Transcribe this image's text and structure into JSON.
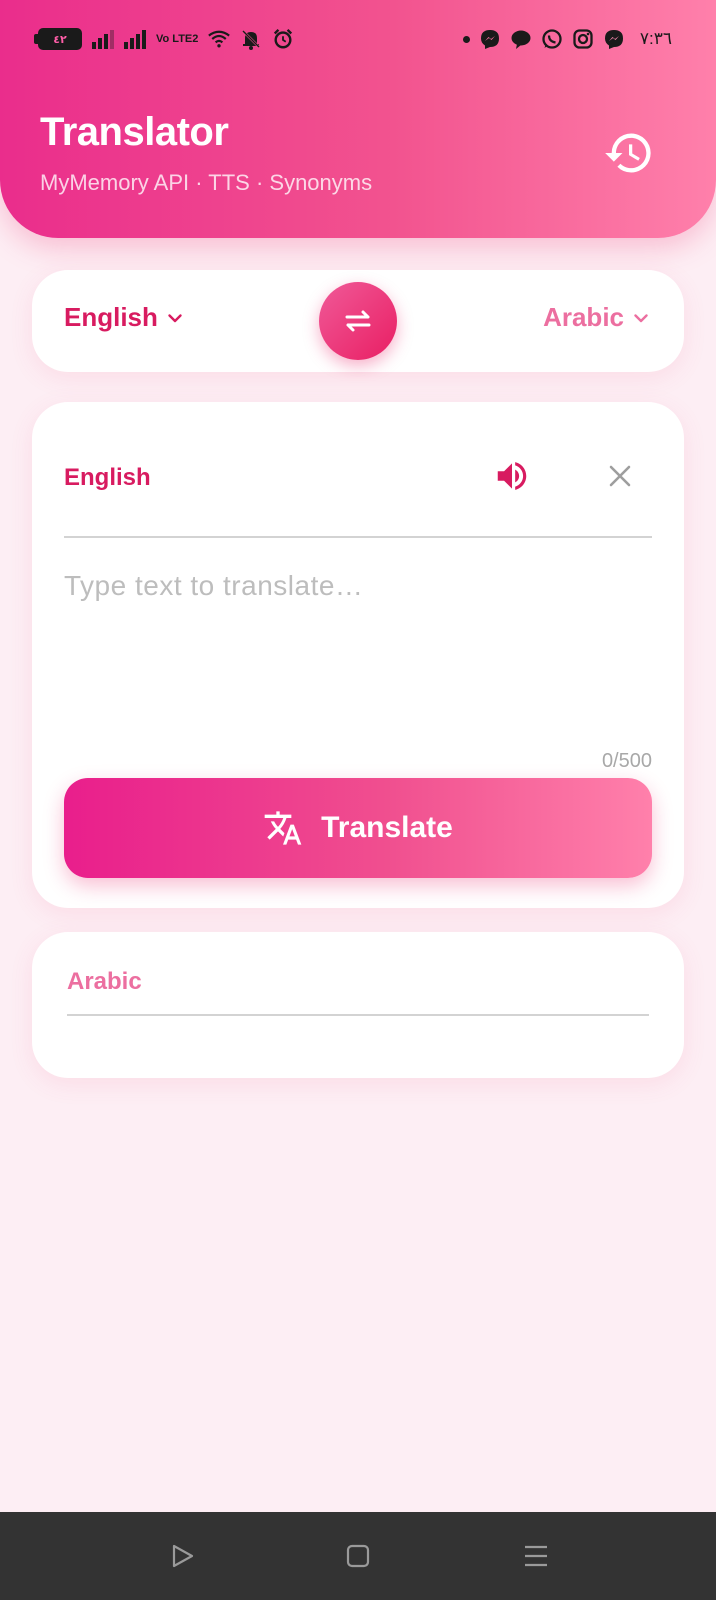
{
  "status_bar": {
    "battery": "٤٢",
    "volte": "Vo LTE2",
    "clock": "٧:٣٦",
    "icons": [
      "signal-icon",
      "signal-icon",
      "volte-icon",
      "wifi-icon",
      "bell-off-icon",
      "alarm-icon",
      "dot-icon",
      "messenger-icon",
      "chat-icon",
      "whatsapp-icon",
      "instagram-icon",
      "messenger-icon"
    ]
  },
  "header": {
    "title": "Translator",
    "subtitle": "MyMemory API · TTS · Synonyms",
    "history_icon": "history-icon"
  },
  "languages": {
    "source": "English",
    "target": "Arabic",
    "swap_icon": "swap-icon"
  },
  "input_card": {
    "language_label": "English",
    "speak_icon": "speaker-icon",
    "clear_icon": "close-icon",
    "value": "",
    "placeholder": "Type text to translate…",
    "counter": "0/500"
  },
  "translate_button": {
    "label": "Translate",
    "icon": "translate-icon"
  },
  "output_card": {
    "language_label": "Arabic",
    "value": ""
  },
  "nav_bar": {
    "icons": [
      "back-icon",
      "home-icon",
      "menu-icon"
    ]
  },
  "colors": {
    "accent": "#e91e63",
    "accent_light": "#ff80ab",
    "background": "#fdeef4",
    "nav_bar": "#333333"
  }
}
